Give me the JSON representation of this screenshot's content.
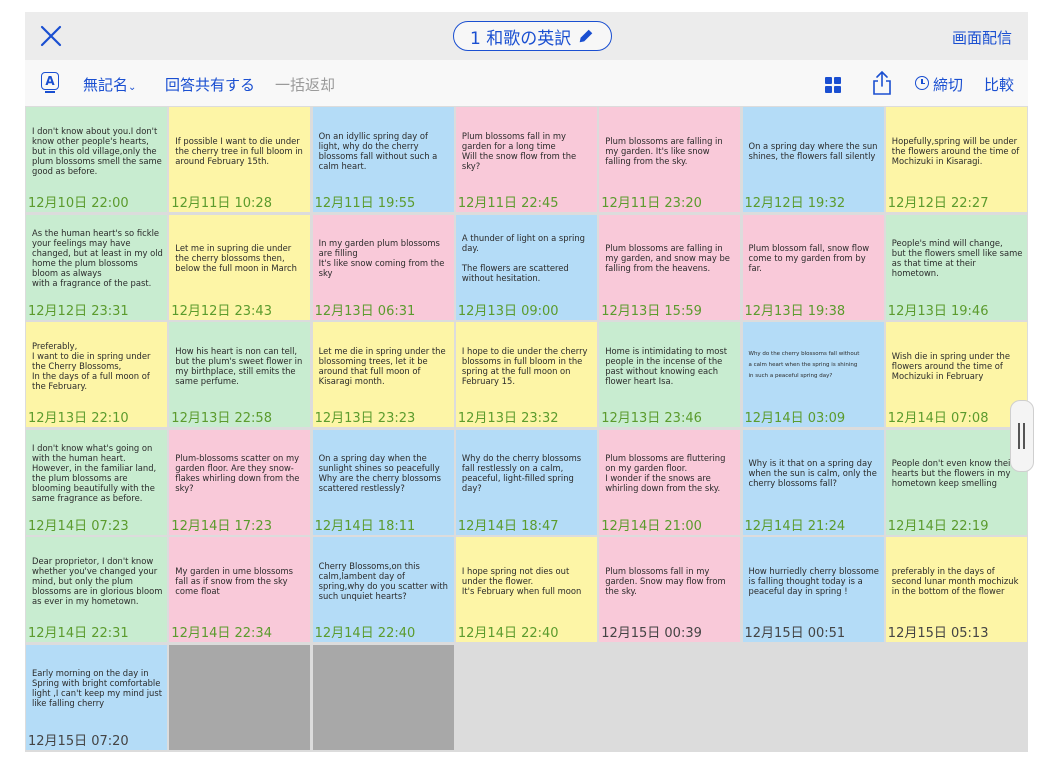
{
  "header": {
    "title": "1 和歌の英訳",
    "broadcast_label": "画面配信"
  },
  "toolbar": {
    "font_icon_letter": "A",
    "anonymous_label": "無記名",
    "share_answers_label": "回答共有する",
    "bulk_return_label": "一括返却",
    "deadline_label": "締切",
    "compare_label": "比較"
  },
  "accent_color": "#1a4fd1",
  "timestamp_color": "#5b9b2d",
  "cards": [
    {
      "color": "green",
      "text": "I don't know about you.I don't know other people's hearts, but in this old village,only the plum blossoms smell the same good as before.",
      "time": "12月10日 22:00"
    },
    {
      "color": "yellow",
      "text": "If possible I want to die under the cherry tree in full bloom in around February 15th.",
      "time": "12月11日 10:28"
    },
    {
      "color": "blue",
      "text": "On an idyllic spring day of light, why do the cherry blossoms fall without such a calm heart.",
      "time": "12月11日 19:55"
    },
    {
      "color": "pink",
      "text": "Plum blossoms fall in my garden for a long time\nWill the snow flow from the sky?",
      "time": "12月11日 22:45"
    },
    {
      "color": "pink",
      "text": "Plum blossoms are falling in my garden. It's like snow falling from the sky.",
      "time": "12月11日 23:20"
    },
    {
      "color": "blue",
      "text": "On a spring day where the sun shines, the flowers fall silently",
      "time": "12月12日 19:32"
    },
    {
      "color": "yellow",
      "text": "Hopefully,spring will be under the flowers around the time of Mochizuki in Kisaragi.",
      "time": "12月12日 22:27"
    },
    {
      "color": "green",
      "text": "As the human heart's so fickle your feelings may have changed, but at least in my old home the plum blossoms bloom as always\nwith a fragrance of the past.",
      "time": "12月12日 23:31"
    },
    {
      "color": "yellow",
      "text": "Let me in supring die under the cherry blossoms then, below the full moon in March",
      "time": "12月12日 23:43"
    },
    {
      "color": "pink",
      "text": "In my garden plum blossoms are filling\nIt's like snow coming from the sky",
      "time": "12月13日 06:31"
    },
    {
      "color": "blue",
      "text": "A thunder of light on a spring day.\n\nThe flowers are scattered\n                without hesitation.",
      "time": "12月13日 09:00"
    },
    {
      "color": "pink",
      "text": "Plum blossoms are falling in my garden, and snow may be falling from the heavens.",
      "time": "12月13日 15:59"
    },
    {
      "color": "pink",
      "text": "Plum blossom fall, snow flow come to my garden from by far.",
      "time": "12月13日 19:38"
    },
    {
      "color": "green",
      "text": "People's mind will change,\nbut the flowers smell like same as that time at their hometown.",
      "time": "12月13日 19:46"
    },
    {
      "color": "yellow",
      "text": "Preferably,\nI want to die in spring under the Cherry Blossoms,\nIn the days of a full moon of the February.",
      "time": "12月13日 22:10"
    },
    {
      "color": "green",
      "text": "How his heart is non can tell, but the plum's sweet flower in my birthplace, still emits the same perfume.",
      "time": "12月13日 22:58"
    },
    {
      "color": "yellow",
      "text": "Let me die in spring under the blossoming trees, let it be around that full moon of Kisaragi month.",
      "time": "12月13日 23:23"
    },
    {
      "color": "yellow",
      "text": "I hope to die under the cherry blossoms in full bloom in the spring at the full moon on February 15.",
      "time": "12月13日 23:32"
    },
    {
      "color": "green",
      "text": "Home is intimidating to most people in the incense of the past without knowing each flower heart Isa.",
      "time": "12月13日 23:46"
    },
    {
      "color": "blue",
      "text": "Why do the cherry blossoms fall without\na calm heart when the spring is shining\nin such a peaceful spring day?",
      "time": "12月14日 03:09",
      "small": true
    },
    {
      "color": "yellow",
      "text": "Wish die in spring under the flowers around the time of Mochizuki in February",
      "time": "12月14日 07:08"
    },
    {
      "color": "green",
      "text": "I don't know what's going on with the human heart.  However, in the familiar land, the plum blossoms are blooming beautifully with the same fragrance as before.",
      "time": "12月14日 07:23"
    },
    {
      "color": "pink",
      "text": "Plum-blossoms scatter on my garden floor. Are they snow-flakes whirling down from the sky?",
      "time": "12月14日 17:23"
    },
    {
      "color": "blue",
      "text": "On a spring day when the sunlight shines so peacefully\nWhy are the cherry blossoms scattered restlessly?",
      "time": "12月14日 18:11"
    },
    {
      "color": "blue",
      "text": "Why do the cherry blossoms fall restlessly on a calm, peaceful, light-filled spring day?",
      "time": "12月14日 18:47"
    },
    {
      "color": "pink",
      "text": "Plum blossoms are fluttering on my garden floor.\nI wonder if the snows are whirling down from the sky.",
      "time": "12月14日 21:00"
    },
    {
      "color": "blue",
      "text": "Why is it that on a spring day when the sun is calm, only the cherry blossoms fall?",
      "time": "12月14日 21:24"
    },
    {
      "color": "green",
      "text": "People don't even know their hearts  but the flowers in my hometown keep smelling",
      "time": "12月14日 22:19"
    },
    {
      "color": "green",
      "text": "Dear proprietor, I don't know whether you've changed your mind, but only the plum blossoms are in glorious bloom as ever in my hometown.",
      "time": "12月14日 22:31"
    },
    {
      "color": "pink",
      "text": "My garden in  ume blossoms fall as if  snow from the sky  come float",
      "time": "12月14日 22:34"
    },
    {
      "color": "blue",
      "text": "Cherry Blossoms,on this calm,lambent day of spring,why do you scatter with such unquiet hearts?",
      "time": "12月14日 22:40"
    },
    {
      "color": "yellow",
      "text": "I hope spring not dies out under the flower.\nIt's February when full moon",
      "time": "12月14日 22:40"
    },
    {
      "color": "pink",
      "text": "Plum blossoms fall in my garden. Snow may flow from the sky.",
      "time": "12月15日 00:39",
      "graytime": true
    },
    {
      "color": "blue",
      "text": "How hurriedly  cherry blossome is falling thought today is a peaceful day in spring !",
      "time": "12月15日 00:51",
      "graytime": true
    },
    {
      "color": "yellow",
      "text": "preferably  in  the  days  of second  lunar  month  mochizuk  in  the  bottom  of  the  flower",
      "time": "12月15日 05:13",
      "graytime": true
    },
    {
      "color": "blue",
      "text": "Early morning on the day in Spring with bright comfortable light ,I can't keep my mind just like falling cherry",
      "time": "12月15日 07:20",
      "graytime": true
    },
    {
      "color": "empty",
      "text": "",
      "time": ""
    },
    {
      "color": "empty",
      "text": "",
      "time": ""
    },
    {
      "color": "blank",
      "text": "",
      "time": ""
    },
    {
      "color": "blank",
      "text": "",
      "time": ""
    },
    {
      "color": "blank",
      "text": "",
      "time": ""
    },
    {
      "color": "blank",
      "text": "",
      "time": ""
    }
  ]
}
